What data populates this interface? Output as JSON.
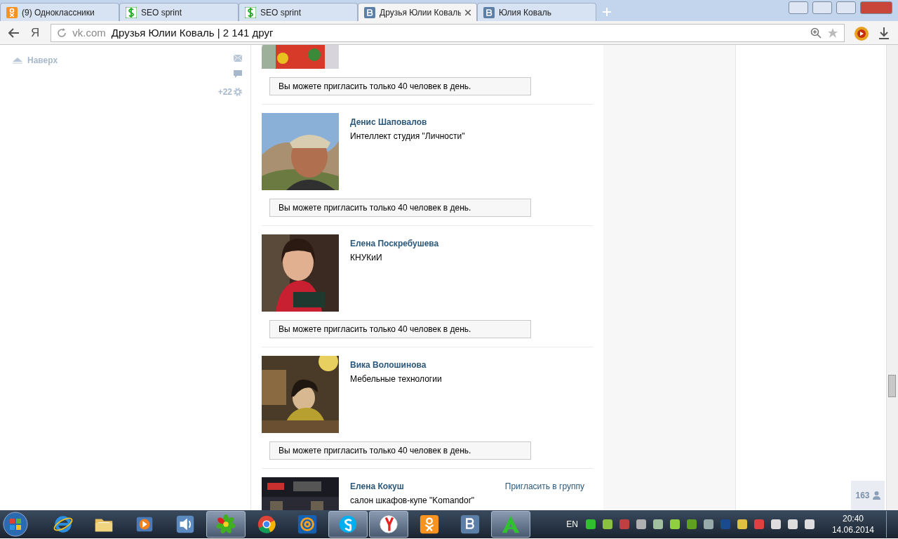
{
  "browser": {
    "tabs": [
      {
        "kind": "ok",
        "title": "(9) Одноклассники",
        "selected": false
      },
      {
        "kind": "seo",
        "title": "SEO sprint",
        "selected": false
      },
      {
        "kind": "seo",
        "title": "SEO sprint",
        "selected": false
      },
      {
        "kind": "vk",
        "title": "Друзья Юлии Коваль",
        "selected": true
      },
      {
        "kind": "vk",
        "title": "Юлия Коваль",
        "selected": false
      }
    ],
    "yandex_button": "Я",
    "address": {
      "domain": "vk.com",
      "title": "Друзья Юлии Коваль | 2 141 друг"
    }
  },
  "left_menu": {
    "to_top": "Наверх",
    "counter": "+22"
  },
  "friends": [
    {
      "note": "Вы можете пригласить только 40 человек в день."
    },
    {
      "name": "Денис Шаповалов",
      "subtitle": "Интеллект студия \"Личности\"",
      "note": "Вы можете пригласить только 40 человек в день."
    },
    {
      "name": "Елена Поскребушева",
      "subtitle": "КНУКиИ",
      "note": "Вы можете пригласить только 40 человек в день."
    },
    {
      "name": "Вика Волошинова",
      "subtitle": "Мебельные технологии",
      "note": "Вы можете пригласить только 40 человек в день."
    },
    {
      "name": "Елена Кокуш",
      "subtitle": "салон шкафов-купе \"Komandor\"",
      "action": "Пригласить в группу"
    }
  ],
  "online_count": "163",
  "taskbar": {
    "apps": [
      {
        "kind": "ie",
        "running": false
      },
      {
        "kind": "folder",
        "running": false
      },
      {
        "kind": "player",
        "running": false
      },
      {
        "kind": "sound",
        "running": false
      },
      {
        "kind": "icq",
        "running": true
      },
      {
        "kind": "chrome",
        "running": false
      },
      {
        "kind": "mail",
        "running": false
      },
      {
        "kind": "skype",
        "running": true
      },
      {
        "kind": "yandex",
        "running": true
      },
      {
        "kind": "ok",
        "running": false
      },
      {
        "kind": "vk",
        "running": false
      },
      {
        "kind": "agent",
        "running": true
      }
    ],
    "language": "EN",
    "time": "20:40",
    "date": "14.06.2014"
  }
}
